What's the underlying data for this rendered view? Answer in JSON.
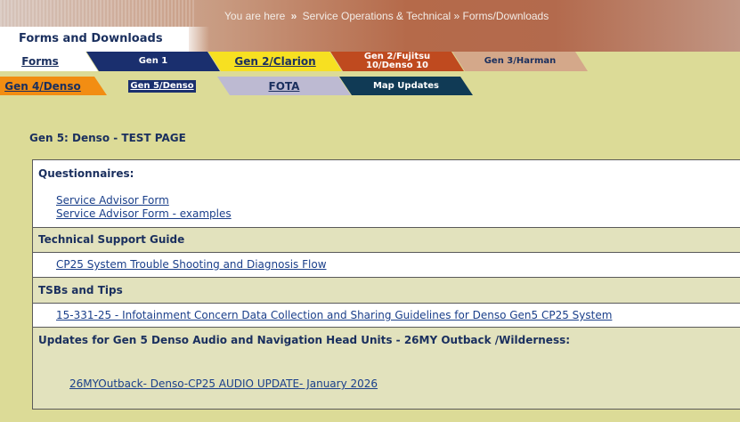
{
  "header": {
    "breadcrumb_prefix": "You are here",
    "breadcrumb_arrow": "»",
    "breadcrumb_path": "Service Operations & Technical » Forms/Downloads",
    "page_title": "Forms and Downloads"
  },
  "tabs": {
    "row1": [
      {
        "label": "Forms"
      },
      {
        "label": "Gen 1"
      },
      {
        "label": "Gen 2/Clarion"
      },
      {
        "label_line1": "Gen 2/Fujitsu",
        "label_line2": "10/Denso 10"
      },
      {
        "label": "Gen 3/Harman"
      }
    ],
    "row2": [
      {
        "label": "Gen 4/Denso"
      },
      {
        "label": "Gen 5/Denso"
      },
      {
        "label": "FOTA"
      },
      {
        "label": "Map Updates"
      }
    ]
  },
  "content": {
    "section_title": "Gen 5: Denso - TEST PAGE",
    "questionnaires": {
      "heading": "Questionnaires:",
      "links": [
        "Service Advisor Form",
        "Service Advisor Form - examples"
      ]
    },
    "tech_support": {
      "heading": "Technical Support Guide",
      "links": [
        "CP25 System Trouble Shooting and Diagnosis Flow"
      ]
    },
    "tsbs": {
      "heading": "TSBs and Tips",
      "links": [
        "15-331-25 - Infotainment Concern Data Collection and Sharing Guidelines for Denso Gen5 CP25 System"
      ]
    },
    "updates": {
      "heading": "Updates for Gen 5 Denso Audio and Navigation Head Units - 26MY Outback /Wilderness:",
      "links": [
        "26MYOutback- Denso-CP25 AUDIO UPDATE- January 2026"
      ]
    }
  },
  "colors": {
    "page_bg": "#dcdb97",
    "navy": "#1a2f5e",
    "link": "#1a3f8a"
  }
}
